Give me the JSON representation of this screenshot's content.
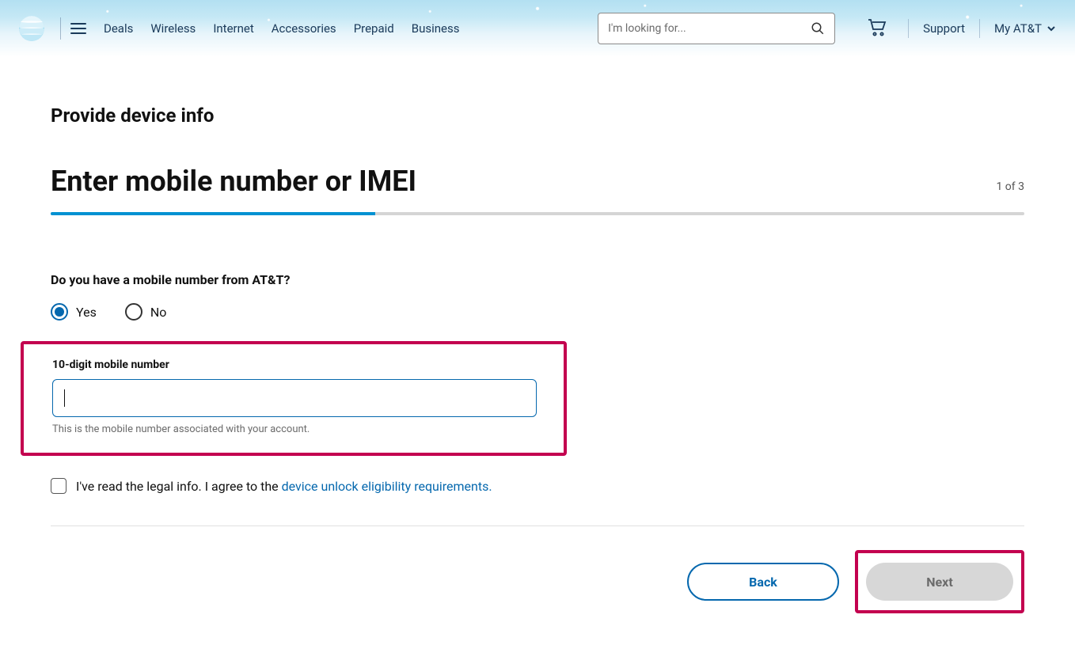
{
  "header": {
    "nav": [
      "Deals",
      "Wireless",
      "Internet",
      "Accessories",
      "Prepaid",
      "Business"
    ],
    "search_placeholder": "I'm looking for...",
    "support": "Support",
    "account": "My AT&T"
  },
  "page": {
    "title": "Provide device info",
    "step_title": "Enter mobile number or IMEI",
    "step_counter": "1 of 3"
  },
  "form": {
    "question": "Do you have a mobile number from AT&T?",
    "yes": "Yes",
    "no": "No",
    "field_label": "10-digit mobile number",
    "field_helper": "This is the mobile number associated with your account.",
    "agree_prefix": "I've read the legal info. I agree to the ",
    "agree_link": "device unlock eligibility requirements.",
    "back": "Back",
    "next": "Next"
  }
}
